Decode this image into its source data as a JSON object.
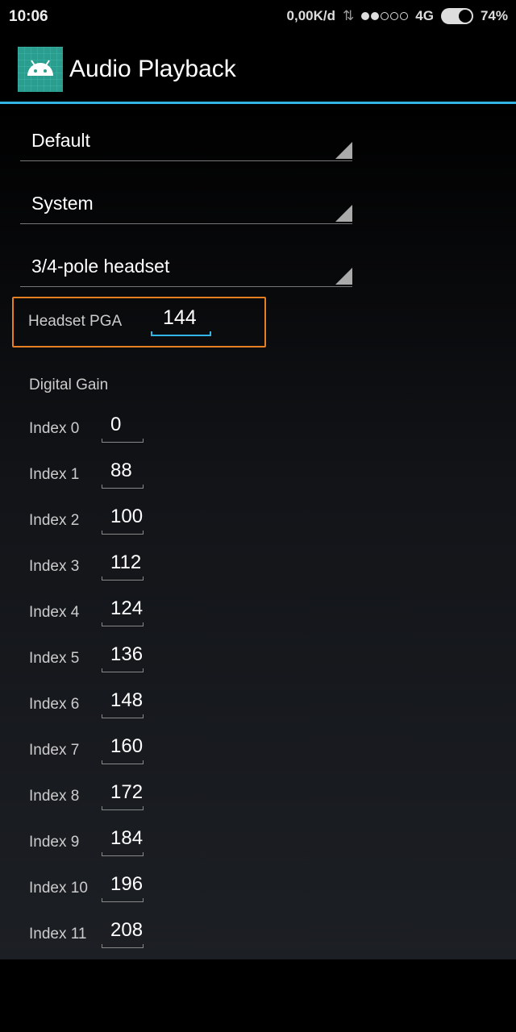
{
  "status_bar": {
    "time": "10:06",
    "net_speed": "0,00K/d",
    "data_icon": "⇅",
    "signal_filled": 2,
    "signal_total": 5,
    "network": "4G",
    "battery": "74%"
  },
  "app_bar": {
    "title": "Audio Playback",
    "icon": "android-icon"
  },
  "spinners": {
    "mode": "Default",
    "stream": "System",
    "device": "3/4-pole headset"
  },
  "headset_pga": {
    "label": "Headset PGA",
    "value": "144"
  },
  "digital_gain": {
    "label": "Digital Gain",
    "rows": [
      {
        "label": "Index 0",
        "value": "0"
      },
      {
        "label": "Index 1",
        "value": "88"
      },
      {
        "label": "Index 2",
        "value": "100"
      },
      {
        "label": "Index 3",
        "value": "112"
      },
      {
        "label": "Index 4",
        "value": "124"
      },
      {
        "label": "Index 5",
        "value": "136"
      },
      {
        "label": "Index 6",
        "value": "148"
      },
      {
        "label": "Index 7",
        "value": "160"
      },
      {
        "label": "Index 8",
        "value": "172"
      },
      {
        "label": "Index 9",
        "value": "184"
      },
      {
        "label": "Index 10",
        "value": "196"
      },
      {
        "label": "Index 11",
        "value": "208"
      }
    ]
  }
}
